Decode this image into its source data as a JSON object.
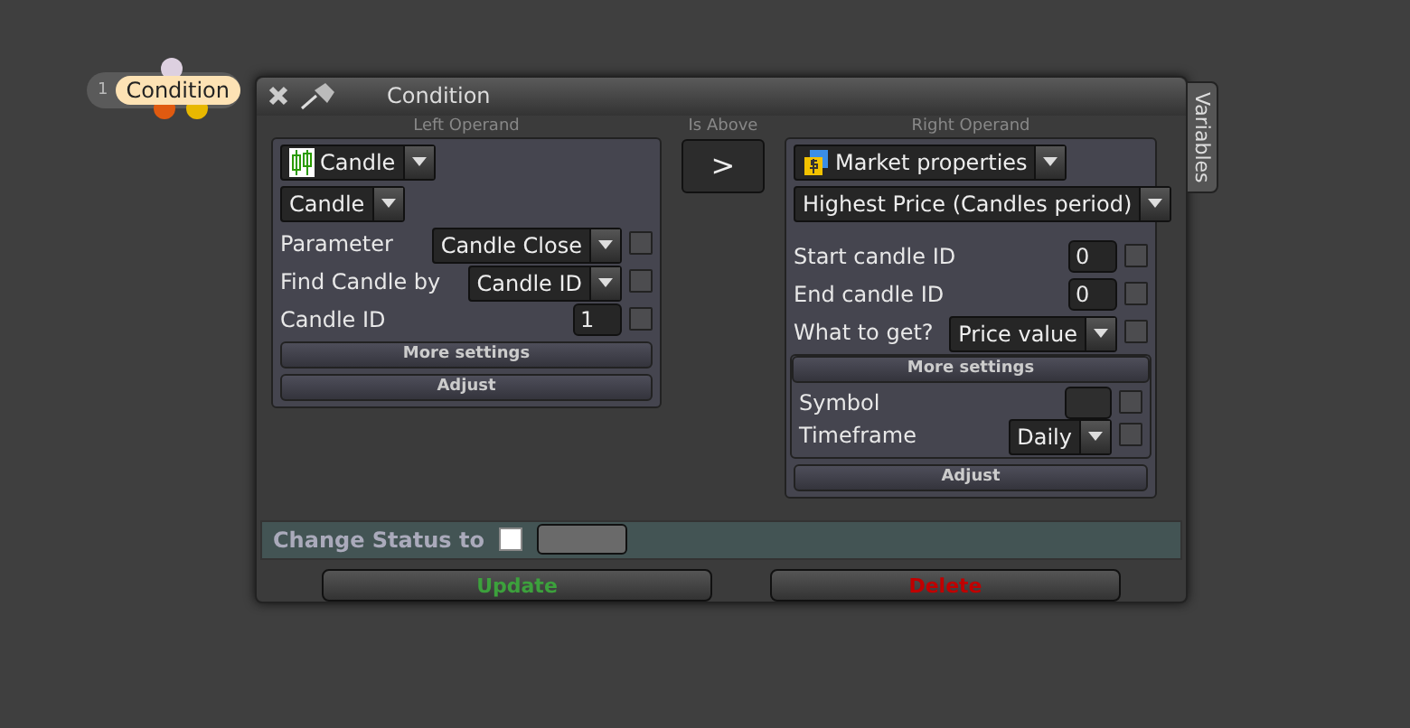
{
  "node": {
    "number": "1",
    "label": "Condition"
  },
  "window": {
    "title": "Condition",
    "side_tab": "Variables"
  },
  "left_operand": {
    "heading": "Left Operand",
    "source": "Candle",
    "type": "Candle",
    "rows": [
      {
        "label": "Parameter",
        "value": "Candle Close",
        "kind": "dropdown",
        "checked": false
      },
      {
        "label": "Find Candle by",
        "value": "Candle ID",
        "kind": "dropdown",
        "checked": false
      },
      {
        "label": "Candle ID",
        "value": "1",
        "kind": "number",
        "checked": false
      }
    ],
    "more_settings": "More settings",
    "adjust": "Adjust"
  },
  "operator": {
    "heading": "Is Above",
    "symbol": ">"
  },
  "right_operand": {
    "heading": "Right Operand",
    "source": "Market properties",
    "function": "Highest Price (Candles period)",
    "rows": [
      {
        "label": "Start candle ID",
        "value": "0",
        "kind": "number",
        "checked": false
      },
      {
        "label": "End candle ID",
        "value": "0",
        "kind": "number",
        "checked": false
      },
      {
        "label": "What to get?",
        "value": "Price value",
        "kind": "dropdown",
        "checked": false
      }
    ],
    "more_settings": {
      "title": "More settings",
      "rows": [
        {
          "label": "Symbol",
          "kind": "swatch",
          "checked": false
        },
        {
          "label": "Timeframe",
          "value": "Daily",
          "kind": "dropdown",
          "checked": false
        }
      ]
    },
    "adjust": "Adjust"
  },
  "status": {
    "label": "Change Status to",
    "checked": false
  },
  "buttons": [
    {
      "label": "Update",
      "kind": "update"
    },
    {
      "label": "Delete",
      "kind": "delete"
    }
  ]
}
